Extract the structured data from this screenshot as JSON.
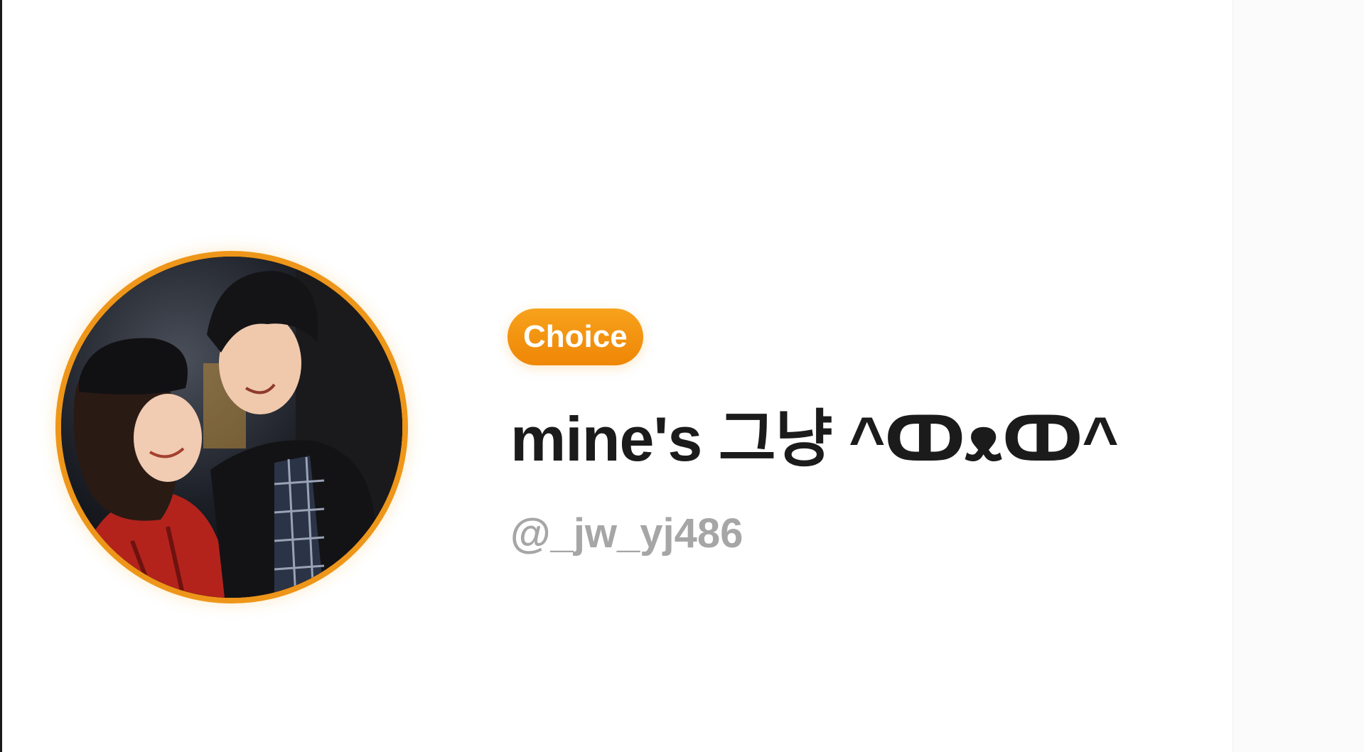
{
  "profile": {
    "badge_label": "Choice",
    "display_name": "mine's 그냥 ^ↀᴥↀ^",
    "handle": "@_jw_yj486"
  },
  "colors": {
    "accent": "#ef8a0c",
    "avatar_ring": "#ee9619",
    "name_text": "#1b1b1b",
    "handle_text": "#a6a6a6"
  }
}
